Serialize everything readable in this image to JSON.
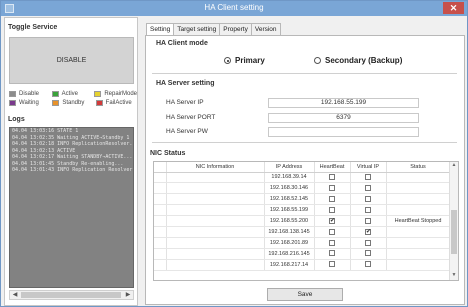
{
  "window": {
    "title": "HA Client setting",
    "close": "✕"
  },
  "toggle_service": {
    "title": "Toggle Service",
    "button": "DISABLE"
  },
  "legend": [
    {
      "label": "Disable",
      "color": "#8c8c8c"
    },
    {
      "label": "Active",
      "color": "#3aa23a"
    },
    {
      "label": "RepairMode",
      "color": "#e6d22e"
    },
    {
      "label": "Waiting",
      "color": "#7a3a8c"
    },
    {
      "label": "Standby",
      "color": "#e8922a"
    },
    {
      "label": "FailActive",
      "color": "#d23a3a"
    }
  ],
  "logs": {
    "title": "Logs",
    "lines": [
      "04.04 13:03:16  STATE 1",
      "04.04 13:02:35  Waiting  ACTIVE→Standby 1",
      "04.04 13:02:18  INFO  ReplicationResolver...",
      "04.04 13:02:13  ACTIVE",
      "04.04 13:02:17  Waiting  STANDBY→ACTIVE...",
      "04.04 13:01:45  Standby  Re-enabling...",
      "04.04 13:01:43  INFO  Replication Resolver..."
    ]
  },
  "tabs": [
    "Setting",
    "Target setting",
    "Property",
    "Version"
  ],
  "ha_client_mode": {
    "title": "HA Client mode",
    "primary": "Primary",
    "secondary": "Secondary (Backup)"
  },
  "ha_server": {
    "title": "HA Server setting",
    "ip_label": "HA Server IP",
    "ip": "192.168.55.199",
    "port_label": "HA Server PORT",
    "port": "6379",
    "pw_label": "HA Server PW",
    "pw": ""
  },
  "nic": {
    "title": "NIC Status",
    "headers": [
      "NIC Information",
      "IP Address",
      "HeartBeat",
      "Virtual IP",
      "Status"
    ],
    "rows": [
      {
        "ip": "192.168.39.14",
        "hb": false,
        "vip": false,
        "status": ""
      },
      {
        "ip": "192.168.30.146",
        "hb": false,
        "vip": false,
        "status": ""
      },
      {
        "ip": "192.168.52.145",
        "hb": false,
        "vip": false,
        "status": ""
      },
      {
        "ip": "192.168.55.199",
        "hb": false,
        "vip": false,
        "status": ""
      },
      {
        "ip": "192.168.55.200",
        "hb": true,
        "vip": false,
        "status": "HeartBeat Stopped"
      },
      {
        "ip": "192.168.138.145",
        "hb": false,
        "vip": true,
        "status": ""
      },
      {
        "ip": "192.168.201.89",
        "hb": false,
        "vip": false,
        "status": ""
      },
      {
        "ip": "192.168.216.145",
        "hb": false,
        "vip": false,
        "status": ""
      },
      {
        "ip": "192.168.217.14",
        "hb": false,
        "vip": false,
        "status": ""
      }
    ]
  },
  "save_label": "Save"
}
